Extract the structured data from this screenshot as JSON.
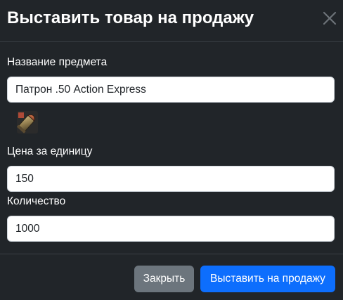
{
  "modal": {
    "title": "Выставить товар на продажу",
    "close_icon": "close-icon"
  },
  "form": {
    "item_name": {
      "label": "Название предмета",
      "value": "Патрон .50 Action Express"
    },
    "item_icon": "ammo-cartridge-icon",
    "unit_price": {
      "label": "Цена за единицу",
      "value": "150"
    },
    "quantity": {
      "label": "Количество",
      "value": "1000"
    }
  },
  "footer": {
    "close_label": "Закрыть",
    "submit_label": "Выставить на продажу"
  },
  "colors": {
    "background": "#212529",
    "primary_button": "#0d6efd",
    "secondary_button": "#6c757d"
  }
}
